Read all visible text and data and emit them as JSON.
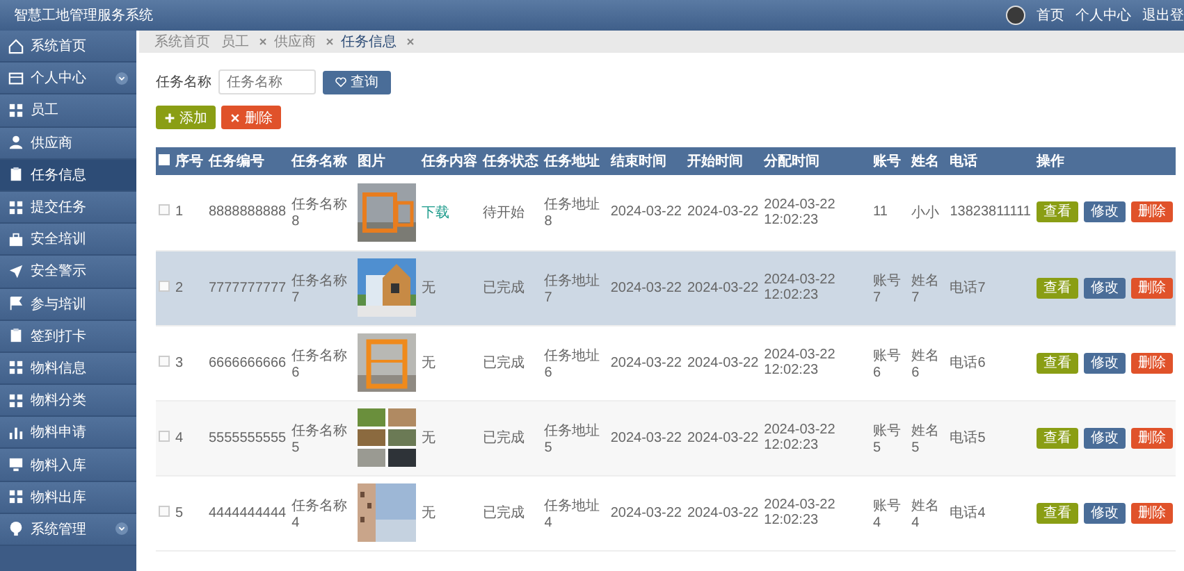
{
  "header": {
    "title": "智慧工地管理服务系统",
    "links": [
      "首页",
      "个人中心",
      "退出登"
    ]
  },
  "sidebar": {
    "items": [
      {
        "label": "系统首页",
        "selected": false,
        "expandable": false
      },
      {
        "label": "个人中心",
        "selected": false,
        "expandable": true
      },
      {
        "label": "员工",
        "selected": false,
        "expandable": false
      },
      {
        "label": "供应商",
        "selected": false,
        "expandable": false
      },
      {
        "label": "任务信息",
        "selected": true,
        "expandable": false
      },
      {
        "label": "提交任务",
        "selected": false,
        "expandable": false
      },
      {
        "label": "安全培训",
        "selected": false,
        "expandable": false
      },
      {
        "label": "安全警示",
        "selected": false,
        "expandable": false
      },
      {
        "label": "参与培训",
        "selected": false,
        "expandable": false
      },
      {
        "label": "签到打卡",
        "selected": false,
        "expandable": false
      },
      {
        "label": "物料信息",
        "selected": false,
        "expandable": false
      },
      {
        "label": "物料分类",
        "selected": false,
        "expandable": false
      },
      {
        "label": "物料申请",
        "selected": false,
        "expandable": false
      },
      {
        "label": "物料入库",
        "selected": false,
        "expandable": false
      },
      {
        "label": "物料出库",
        "selected": false,
        "expandable": false
      },
      {
        "label": "系统管理",
        "selected": false,
        "expandable": true
      }
    ]
  },
  "breadcrumb": [
    {
      "label": "系统首页",
      "closable": false,
      "selected": false
    },
    {
      "label": "员工",
      "closable": true,
      "selected": false
    },
    {
      "label": "供应商",
      "closable": true,
      "selected": false
    },
    {
      "label": "任务信息",
      "closable": true,
      "selected": true
    }
  ],
  "search": {
    "label": "任务名称",
    "placeholder": "任务名称",
    "button": "查询"
  },
  "actions": [
    "添加",
    "删除"
  ],
  "table": {
    "select_all": {
      "checked": false
    },
    "columns": [
      "序号",
      "任务编号",
      "任务名称",
      "图片",
      "任务内容",
      "任务状态",
      "任务地址",
      "结束时间",
      "开始时间",
      "分配时间",
      "账号",
      "姓名",
      "电话",
      "操作"
    ],
    "rows": [
      {
        "selected": false,
        "checked": false,
        "cells": [
          "1",
          "8888888888",
          "任务名称8",
          {
            "kind": "picture"
          },
          {
            "kind": "link",
            "text": "下载"
          },
          "待开始",
          "任务地址8",
          "2024-03-22",
          "2024-03-22",
          "2024-03-22 12:02:23",
          "11",
          "小小",
          "13823811111"
        ],
        "buttons": [
          "查看",
          "修改",
          "删除"
        ]
      },
      {
        "selected": true,
        "checked": false,
        "cells": [
          "2",
          "7777777777",
          "任务名称7",
          {
            "kind": "picture"
          },
          {
            "kind": "text",
            "text": "无"
          },
          "已完成",
          "任务地址7",
          "2024-03-22",
          "2024-03-22",
          "2024-03-22 12:02:23",
          "账号7",
          "姓名7",
          "电话7"
        ],
        "buttons": [
          "查看",
          "修改",
          "删除"
        ]
      },
      {
        "selected": false,
        "checked": false,
        "cells": [
          "3",
          "6666666666",
          "任务名称6",
          {
            "kind": "picture"
          },
          {
            "kind": "text",
            "text": "无"
          },
          "已完成",
          "任务地址6",
          "2024-03-22",
          "2024-03-22",
          "2024-03-22 12:02:23",
          "账号6",
          "姓名6",
          "电话6"
        ],
        "buttons": [
          "查看",
          "修改",
          "删除"
        ]
      },
      {
        "selected": false,
        "checked": false,
        "cells": [
          "4",
          "5555555555",
          "任务名称5",
          {
            "kind": "picture"
          },
          {
            "kind": "text",
            "text": "无"
          },
          "已完成",
          "任务地址5",
          "2024-03-22",
          "2024-03-22",
          "2024-03-22 12:02:23",
          "账号5",
          "姓名5",
          "电话5"
        ],
        "buttons": [
          "查看",
          "修改",
          "删除"
        ]
      },
      {
        "selected": false,
        "checked": false,
        "cells": [
          "5",
          "4444444444",
          "任务名称4",
          {
            "kind": "picture"
          },
          {
            "kind": "text",
            "text": "无"
          },
          "已完成",
          "任务地址4",
          "2024-03-22",
          "2024-03-22",
          "2024-03-22 12:02:23",
          "账号4",
          "姓名4",
          "电话4"
        ],
        "buttons": [
          "查看",
          "修改",
          "删除"
        ]
      }
    ]
  }
}
